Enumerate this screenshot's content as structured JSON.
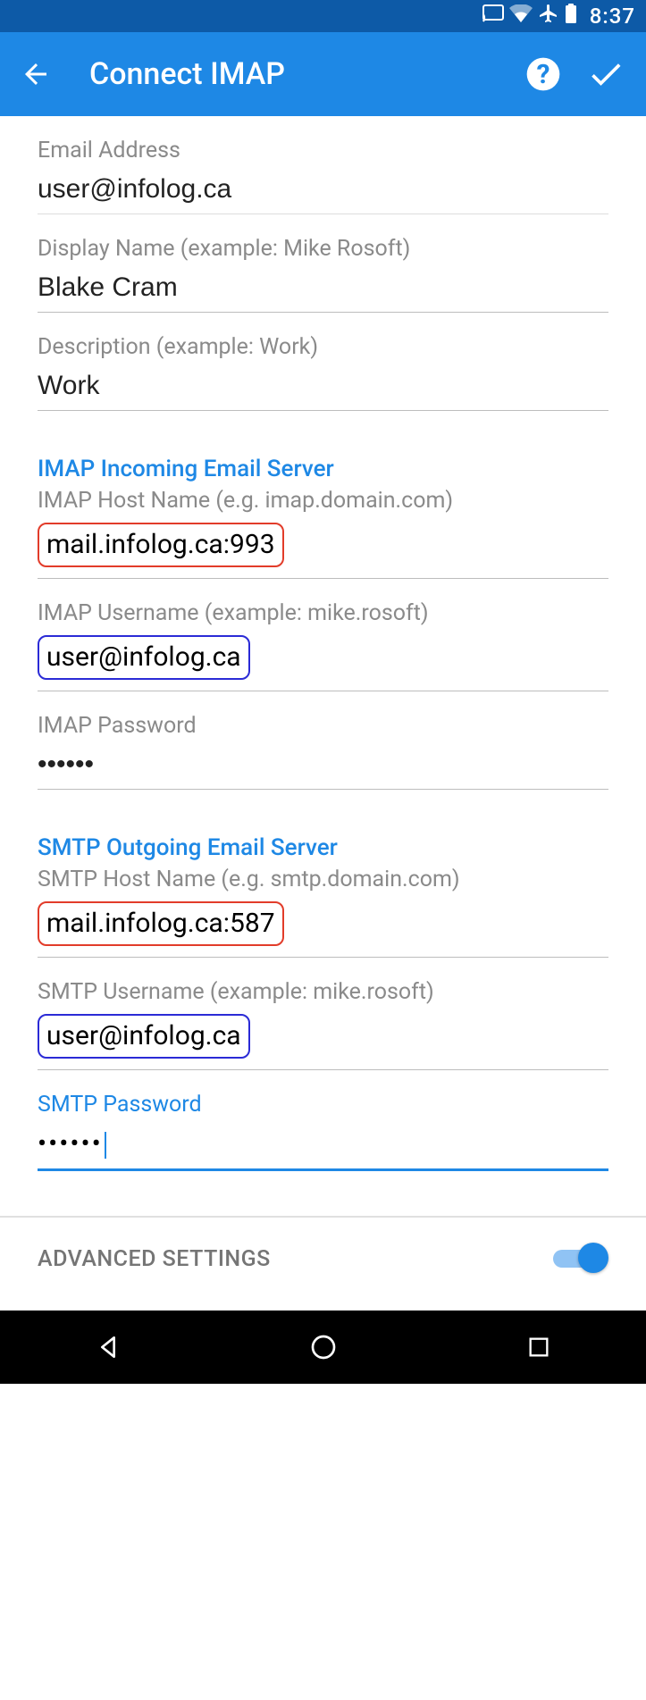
{
  "status": {
    "time": "8:37",
    "icons": [
      "cast-icon",
      "wifi-icon",
      "airplane-icon",
      "battery-icon"
    ]
  },
  "appbar": {
    "title": "Connect IMAP"
  },
  "fields": {
    "email": {
      "label": "Email Address",
      "value": "user@infolog.ca"
    },
    "display_name": {
      "label": "Display Name (example: Mike Rosoft)",
      "value": "Blake Cram"
    },
    "description": {
      "label": "Description (example: Work)",
      "value": "Work"
    }
  },
  "imap": {
    "section": "IMAP Incoming Email Server",
    "host": {
      "label": "IMAP Host Name (e.g. imap.domain.com)",
      "value": "mail.infolog.ca:993"
    },
    "user": {
      "label": "IMAP Username (example: mike.rosoft)",
      "value": "user@infolog.ca"
    },
    "pass": {
      "label": "IMAP Password",
      "value": "••••••"
    }
  },
  "smtp": {
    "section": "SMTP Outgoing Email Server",
    "host": {
      "label": "SMTP Host Name (e.g. smtp.domain.com)",
      "value": "mail.infolog.ca:587"
    },
    "user": {
      "label": "SMTP Username (example: mike.rosoft)",
      "value": "user@infolog.ca"
    },
    "pass": {
      "label": "SMTP Password",
      "value": "••••••"
    }
  },
  "advanced": {
    "label": "ADVANCED SETTINGS",
    "enabled": true
  }
}
